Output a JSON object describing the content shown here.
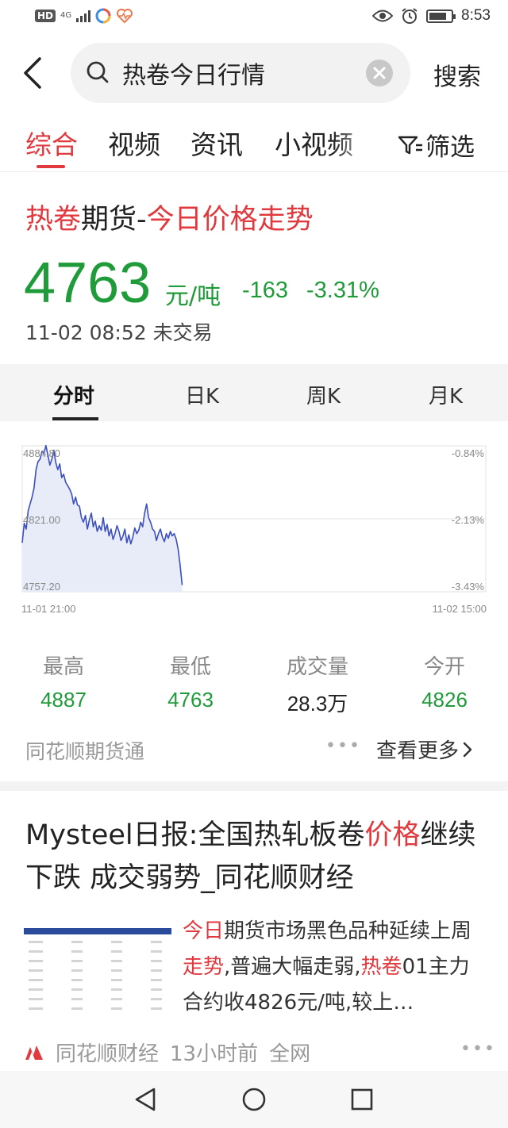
{
  "status_bar": {
    "network_badge": "HD",
    "network_type": "4G",
    "time": "8:53",
    "icons": [
      "hd-icon",
      "signal-icon",
      "app-icon",
      "health-icon",
      "eye-icon",
      "alarm-icon",
      "battery-icon"
    ],
    "battery_level": 0.8
  },
  "search": {
    "query": "热卷今日行情",
    "submit_label": "搜索"
  },
  "tabs": {
    "items": [
      "综合",
      "视频",
      "资讯",
      "小视频"
    ],
    "active": "综合",
    "filter_label": "筛选"
  },
  "quote": {
    "title_part1": "热卷",
    "title_part2": "期货-",
    "title_part3": "今日价格走势",
    "price": "4763",
    "unit": "元/吨",
    "change": "-163",
    "change_pct": "-3.31%",
    "time": "11-02 08:52 未交易",
    "color_down": "#1f9b3a"
  },
  "chart_tabs": {
    "items": [
      "分时",
      "日K",
      "周K",
      "月K"
    ],
    "active": "分时"
  },
  "chart_data": {
    "type": "area",
    "y_labels_left": [
      "4884.80",
      "4821.00",
      "4757.20"
    ],
    "y_labels_right": [
      "-0.84%",
      "-2.13%",
      "-3.43%"
    ],
    "x_labels": [
      "11-01 21:00",
      "11-02 15:00"
    ],
    "ylim": [
      4757.2,
      4884.8
    ],
    "session_fraction_elapsed": 0.345,
    "series": [
      {
        "values": [
          4800,
          4817,
          4812,
          4828,
          4834,
          4840,
          4848,
          4864,
          4871,
          4873,
          4880,
          4878,
          4885,
          4877,
          4868,
          4873,
          4881,
          4870,
          4864,
          4869,
          4857,
          4860,
          4853,
          4850,
          4847,
          4843,
          4834,
          4840,
          4833,
          4832,
          4822,
          4818,
          4824,
          4812,
          4820,
          4826,
          4814,
          4819,
          4810,
          4815,
          4811,
          4822,
          4810,
          4816,
          4806,
          4812,
          4803,
          4808,
          4815,
          4810,
          4802,
          4806,
          4812,
          4800,
          4807,
          4799,
          4805,
          4813,
          4808,
          4811,
          4818,
          4814,
          4826,
          4834,
          4822,
          4818,
          4812,
          4810,
          4802,
          4808,
          4812,
          4805,
          4801,
          4808,
          4804,
          4810,
          4806,
          4808,
          4803,
          4794,
          4780,
          4763
        ]
      }
    ],
    "fill_color": "#e8ecf8",
    "line_color": "#3b4fbf"
  },
  "stats": [
    {
      "label": "最高",
      "value": "4887",
      "tone": "green"
    },
    {
      "label": "最低",
      "value": "4763",
      "tone": "green"
    },
    {
      "label": "成交量",
      "value": "28.3万",
      "tone": "dark"
    },
    {
      "label": "今开",
      "value": "4826",
      "tone": "green"
    }
  ],
  "source": {
    "name": "同花顺期货通",
    "more_label": "查看更多"
  },
  "article": {
    "title_a": "Mysteel日报:全国热轧板卷",
    "title_b": "价格",
    "title_c": "继续下跌 成交弱势_同花顺财经",
    "snippet_a": "今日",
    "snippet_b": "期货市场黑色品种延续上周",
    "snippet_c": "走势",
    "snippet_d": ",普遍大幅走弱,",
    "snippet_e": "热卷",
    "snippet_f": "01主力合约收4826元/吨,较上…",
    "source": "同花顺财经",
    "time": "13小时前",
    "scope": "全网"
  }
}
